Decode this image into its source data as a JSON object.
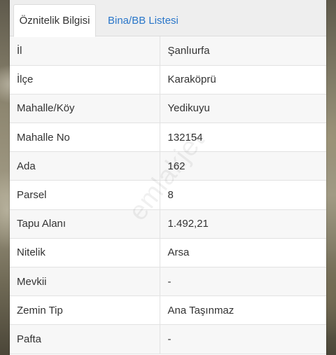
{
  "tabs": [
    {
      "label": "Öznitelik Bilgisi",
      "active": true
    },
    {
      "label": "Bina/BB Listesi",
      "active": false
    }
  ],
  "watermark": "emlakjet",
  "rows": [
    {
      "key": "İl",
      "value": "Şanlıurfa"
    },
    {
      "key": "İlçe",
      "value": "Karaköprü"
    },
    {
      "key": "Mahalle/Köy",
      "value": "Yedikuyu"
    },
    {
      "key": "Mahalle No",
      "value": "132154"
    },
    {
      "key": "Ada",
      "value": "162"
    },
    {
      "key": "Parsel",
      "value": "8"
    },
    {
      "key": "Tapu Alanı",
      "value": "1.492,21"
    },
    {
      "key": "Nitelik",
      "value": "Arsa"
    },
    {
      "key": "Mevkii",
      "value": "-"
    },
    {
      "key": "Zemin Tip",
      "value": "Ana Taşınmaz"
    },
    {
      "key": "Pafta",
      "value": "-"
    }
  ],
  "colors": {
    "link": "#2a76c9",
    "text": "#333333",
    "tabbar": "#eeeeee"
  }
}
